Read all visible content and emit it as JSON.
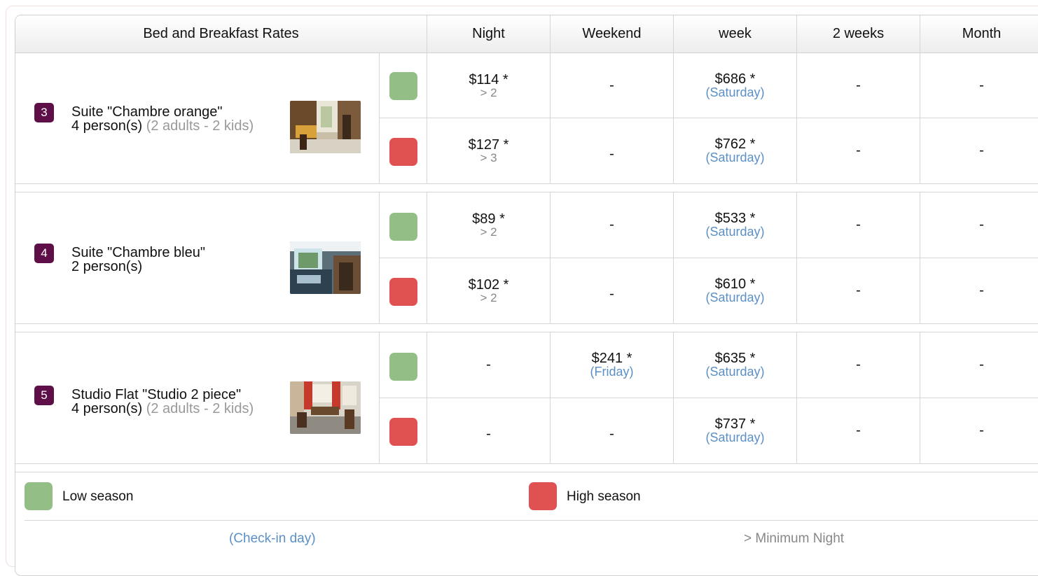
{
  "table": {
    "header": {
      "title": "Bed and Breakfast Rates",
      "columns": [
        "Night",
        "Weekend",
        "week",
        "2 weeks",
        "Month"
      ]
    },
    "rooms": [
      {
        "number": "3",
        "name": "Suite \"Chambre orange\"",
        "persons": "4 person(s)",
        "detail": "(2 adults - 2 kids)",
        "rows": [
          {
            "season": "low",
            "night": "$114 *",
            "night_min": "> 2",
            "weekend": "-",
            "weekend_day": "",
            "week": "$686 *",
            "week_day": "(Saturday)",
            "two_weeks": "-",
            "month": "-"
          },
          {
            "season": "high",
            "night": "$127 *",
            "night_min": "> 3",
            "weekend": "-",
            "weekend_day": "",
            "week": "$762 *",
            "week_day": "(Saturday)",
            "two_weeks": "-",
            "month": "-"
          }
        ]
      },
      {
        "number": "4",
        "name": "Suite \"Chambre bleu\"",
        "persons": "2 person(s)",
        "detail": "",
        "rows": [
          {
            "season": "low",
            "night": "$89 *",
            "night_min": "> 2",
            "weekend": "-",
            "weekend_day": "",
            "week": "$533 *",
            "week_day": "(Saturday)",
            "two_weeks": "-",
            "month": "-"
          },
          {
            "season": "high",
            "night": "$102 *",
            "night_min": "> 2",
            "weekend": "-",
            "weekend_day": "",
            "week": "$610 *",
            "week_day": "(Saturday)",
            "two_weeks": "-",
            "month": "-"
          }
        ]
      },
      {
        "number": "5",
        "name": "Studio Flat \"Studio 2 piece\"",
        "persons": "4 person(s)",
        "detail": "(2 adults - 2 kids)",
        "rows": [
          {
            "season": "low",
            "night": "-",
            "night_min": "",
            "weekend": "$241 *",
            "weekend_day": "(Friday)",
            "week": "$635 *",
            "week_day": "(Saturday)",
            "two_weeks": "-",
            "month": "-"
          },
          {
            "season": "high",
            "night": "-",
            "night_min": "",
            "weekend": "-",
            "weekend_day": "",
            "week": "$737 *",
            "week_day": "(Saturday)",
            "two_weeks": "-",
            "month": "-"
          }
        ]
      }
    ]
  },
  "legend": {
    "low_label": "Low season",
    "high_label": "High season",
    "checkin_label": "(Check-in day)",
    "minimum_label": "> Minimum Night"
  },
  "colors": {
    "low_season": "#93bf87",
    "high_season": "#e05252",
    "badge": "#5e0f47",
    "day_link": "#5b8fc7"
  }
}
